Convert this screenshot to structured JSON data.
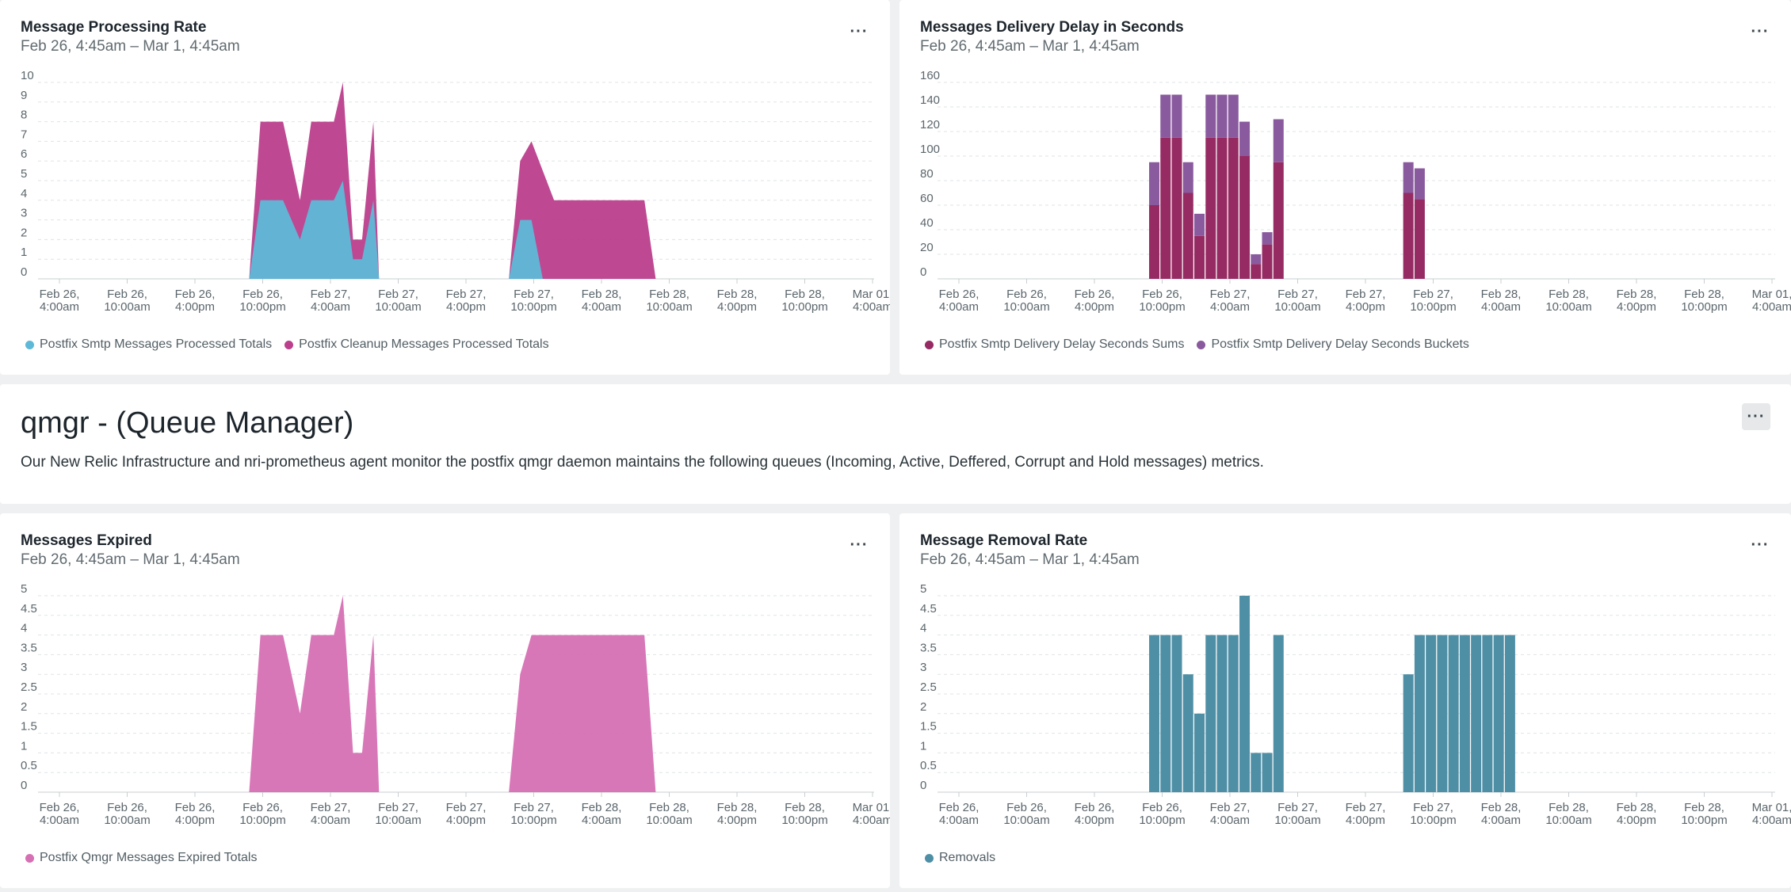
{
  "panels": {
    "processing": {
      "title": "Message Processing Rate",
      "subtitle": "Feb 26, 4:45am – Mar 1, 4:45am"
    },
    "delay": {
      "title": "Messages Delivery Delay in Seconds",
      "subtitle": "Feb 26, 4:45am – Mar 1, 4:45am"
    },
    "expired": {
      "title": "Messages Expired",
      "subtitle": "Feb 26, 4:45am – Mar 1, 4:45am"
    },
    "removal": {
      "title": "Message Removal Rate",
      "subtitle": "Feb 26, 4:45am – Mar 1, 4:45am"
    }
  },
  "markdown": {
    "title": "qmgr - (Queue Manager)",
    "text": "Our New Relic Infrastructure and nri-prometheus agent monitor the postfix qmgr daemon maintains the following queues (Incoming, Active, Deffered, Corrupt and Hold messages) metrics."
  },
  "menu_label": "···",
  "colors": {
    "smtp_processed": "#5eb9d8",
    "cleanup_processed": "#bb3f8c",
    "delay_sums": "#962a62",
    "delay_buckets": "#8a5a9e",
    "expired": "#d670b4",
    "removals": "#4f8fa6"
  },
  "x_tick_labels": [
    [
      "Feb 26,",
      "4:00am"
    ],
    [
      "Feb 26,",
      "10:00am"
    ],
    [
      "Feb 26,",
      "4:00pm"
    ],
    [
      "Feb 26,",
      "10:00pm"
    ],
    [
      "Feb 27,",
      "4:00am"
    ],
    [
      "Feb 27,",
      "10:00am"
    ],
    [
      "Feb 27,",
      "4:00pm"
    ],
    [
      "Feb 27,",
      "10:00pm"
    ],
    [
      "Feb 28,",
      "4:00am"
    ],
    [
      "Feb 28,",
      "10:00am"
    ],
    [
      "Feb 28,",
      "4:00pm"
    ],
    [
      "Feb 28,",
      "10:00pm"
    ],
    [
      "Mar 01,",
      "4:00am"
    ]
  ],
  "chart_data": [
    {
      "id": "processing",
      "type": "area",
      "title": "Message Processing Rate",
      "ylim": [
        0,
        10
      ],
      "yticks": [
        "0",
        "1",
        "2",
        "3",
        "4",
        "5",
        "6",
        "7",
        "8",
        "9",
        "10"
      ],
      "x_unit": "hours since Feb 26, 4:00am",
      "series": [
        {
          "name": "Postfix Cleanup Messages Processed Totals",
          "color": "#bb3f8c",
          "x": [
            16.8,
            17.8,
            19.8,
            21.3,
            22.3,
            24.3,
            25.1,
            26.0,
            26.8,
            27.8,
            28.3,
            29.3,
            39.8,
            40.8,
            41.8,
            43.8,
            44.8,
            51.8,
            52.8
          ],
          "y": [
            0,
            8,
            8,
            4,
            8,
            8,
            10,
            2,
            2,
            8,
            0,
            0,
            0,
            6,
            7,
            4,
            4,
            4,
            0
          ]
        },
        {
          "name": "Postfix Smtp Messages Processed Totals",
          "color": "#5eb9d8",
          "x": [
            16.8,
            17.8,
            19.8,
            21.3,
            22.3,
            24.3,
            25.1,
            26.0,
            26.8,
            27.8,
            28.3,
            39.8,
            40.8,
            41.8,
            42.8
          ],
          "y": [
            0,
            4,
            4,
            2,
            4,
            4,
            5,
            1,
            1,
            4,
            0,
            0,
            3,
            3,
            0
          ]
        }
      ]
    },
    {
      "id": "delay",
      "type": "bar",
      "title": "Messages Delivery Delay in Seconds",
      "ylim": [
        0,
        160
      ],
      "yticks": [
        "0",
        "20",
        "40",
        "60",
        "80",
        "100",
        "120",
        "140",
        "160"
      ],
      "series": [
        {
          "name": "Postfix Smtp Delivery Delay Seconds Sums",
          "color": "#962a62",
          "x": [
            17.3,
            18.3,
            19.3,
            20.3,
            21.3,
            22.3,
            23.3,
            24.3,
            25.3,
            26.3,
            27.3,
            28.3,
            39.8,
            40.8
          ],
          "values": [
            60,
            115,
            115,
            70,
            35,
            115,
            115,
            115,
            100,
            12,
            28,
            95,
            70,
            65
          ]
        },
        {
          "name": "Postfix Smtp Delivery Delay Seconds Buckets",
          "color": "#8a5a9e",
          "x": [
            17.3,
            18.3,
            19.3,
            20.3,
            21.3,
            22.3,
            23.3,
            24.3,
            25.3,
            26.3,
            27.3,
            28.3,
            39.8,
            40.8
          ],
          "values": [
            35,
            35,
            35,
            25,
            18,
            35,
            35,
            35,
            28,
            8,
            10,
            35,
            25,
            25
          ]
        }
      ]
    },
    {
      "id": "expired",
      "type": "area",
      "title": "Messages Expired",
      "ylim": [
        0,
        5
      ],
      "yticks": [
        "0",
        "0.5",
        "1",
        "1.5",
        "2",
        "2.5",
        "3",
        "3.5",
        "4",
        "4.5",
        "5"
      ],
      "series": [
        {
          "name": "Postfix Qmgr Messages Expired Totals",
          "color": "#d670b4",
          "x": [
            16.8,
            17.8,
            19.8,
            21.3,
            22.3,
            24.3,
            25.1,
            26.0,
            26.8,
            27.8,
            28.3,
            29.3,
            39.8,
            40.8,
            41.8,
            51.8,
            52.8
          ],
          "y": [
            0,
            4,
            4,
            2,
            4,
            4,
            5,
            1,
            1,
            4,
            0,
            0,
            0,
            3,
            4,
            4,
            0
          ]
        }
      ]
    },
    {
      "id": "removal",
      "type": "bar",
      "title": "Message Removal Rate",
      "ylim": [
        0,
        5
      ],
      "yticks": [
        "0",
        "0.5",
        "1",
        "1.5",
        "2",
        "2.5",
        "3",
        "3.5",
        "4",
        "4.5",
        "5"
      ],
      "series": [
        {
          "name": "Removals",
          "color": "#4f8fa6",
          "x": [
            17.3,
            18.3,
            19.3,
            20.3,
            21.3,
            22.3,
            23.3,
            24.3,
            25.3,
            26.3,
            27.3,
            28.3,
            39.8,
            40.8,
            41.8,
            42.8,
            43.8,
            44.8,
            45.8,
            46.8,
            47.8,
            48.8
          ],
          "values": [
            4,
            4,
            4,
            3,
            2,
            4,
            4,
            4,
            5,
            1,
            1,
            4,
            3,
            4,
            4,
            4,
            4,
            4,
            4,
            4,
            4,
            4
          ]
        }
      ]
    }
  ]
}
